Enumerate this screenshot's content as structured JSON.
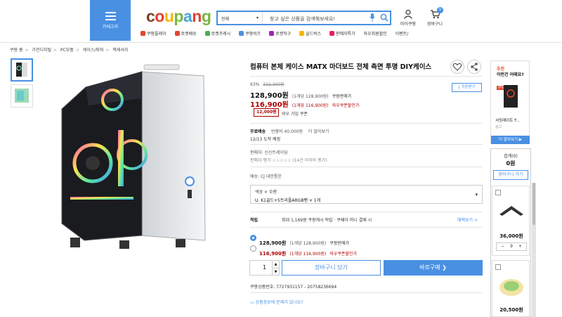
{
  "header": {
    "category_label": "카테고리",
    "logo": {
      "c": "c",
      "o": "o",
      "u": "u",
      "p": "p",
      "a": "a",
      "n": "n",
      "g": "g"
    },
    "search": {
      "category": "전체",
      "placeholder": "찾고 싶은 상품을 검색해보세요!"
    },
    "my_coupang": "마이쿠팡",
    "cart": "장바구니",
    "cart_count": "0",
    "quick_links": [
      {
        "label": "쿠팡플레이",
        "icon": "play-icon",
        "color": "#e2462b"
      },
      {
        "label": "로켓배송",
        "icon": "rocket-icon",
        "color": "#e2462b"
      },
      {
        "label": "로켓프레시",
        "icon": "rocket-fresh-icon",
        "color": "#4caf50"
      },
      {
        "label": "쿠팡비즈",
        "icon": "biz-icon",
        "color": "#4a90e2"
      },
      {
        "label": "로켓직구",
        "icon": "rocket-global-icon",
        "color": "#9c27b0"
      },
      {
        "label": "골드박스",
        "icon": "goldbox-icon",
        "color": "#ffb300"
      },
      {
        "label": "판매자특가",
        "icon": "sale-icon",
        "color": "#e91e63"
      },
      {
        "label": "와우회원할인",
        "icon": "",
        "color": ""
      },
      {
        "label": "이벤트/",
        "icon": "",
        "color": ""
      }
    ]
  },
  "breadcrumb": [
    "쿠팡 홈",
    "가전디지털",
    "PC부품",
    "케이스/파워",
    "액세서리"
  ],
  "product": {
    "title": "컴퓨터 본체 케이스 MATX 마더보드 전체 측면 투명 DIY케이스",
    "discount_rate": "63%",
    "original_price": "322,300원",
    "price": "128,900원",
    "price_unit_note": "(1개당 128,900원)",
    "price_tag": "쿠팡판매가",
    "wow_price": "116,900원",
    "wow_unit_note": "(1개당 116,900원)",
    "wow_tag": "와우쿠폰할인가",
    "coupon_button": "쿠폰받기",
    "coupon_amount": "12,000원",
    "coupon_note": "와우 가입 쿠폰",
    "shipping_label": "무료배송",
    "shipping_note": "반품비 40,000원",
    "shipping_more": "더 알아보기",
    "arrival": "12/13 도착 예정",
    "seller": "판매자: 신신트레이딩",
    "seller_rating": "판매자 평가 ☆☆☆☆☆ (14건 이하의 평가)",
    "delivery": "배송: CJ 대한통운",
    "option_label": "색상 × 수량",
    "option_value": "U. K1골드+5트리플ARGB팬 × 1개",
    "benefit_label": "적립",
    "benefit_text": "최대 1,169원 쿠팡캐시 적립 · 쿠페이 머니 결제 시",
    "benefit_link": "혜택보기 >",
    "options": [
      {
        "price": "128,900원",
        "unit": "(1개당 128,900원)",
        "tag": "쿠팡판매가",
        "selected": true
      },
      {
        "price": "116,900원",
        "unit": "(1개당 116,900원)",
        "tag": "와우쿠폰할인가",
        "selected": false
      }
    ],
    "quantity": "1",
    "add_to_cart": "장바구니 담기",
    "buy_now": "바로구매 ❯",
    "product_code": "쿠팡상품번호: 7727931157 - 20758236694",
    "qna": "상품정보에 문제가 있나요?"
  },
  "right_rail": {
    "ad_label": "추천",
    "ad_title": "이런건 어때요?",
    "ad_discount": "0%",
    "ad_product": "서밋레이트 T...",
    "ad_tag": "광고",
    "ad_button": "더 알아보기 ▶",
    "cart_total_label": "합계(0)",
    "cart_total": "0원",
    "mini_cart_button": "장바구니 가기",
    "recs": [
      {
        "price": "36,000원",
        "qty": "9"
      },
      {
        "price": "20,500원",
        "qty": ""
      }
    ]
  }
}
